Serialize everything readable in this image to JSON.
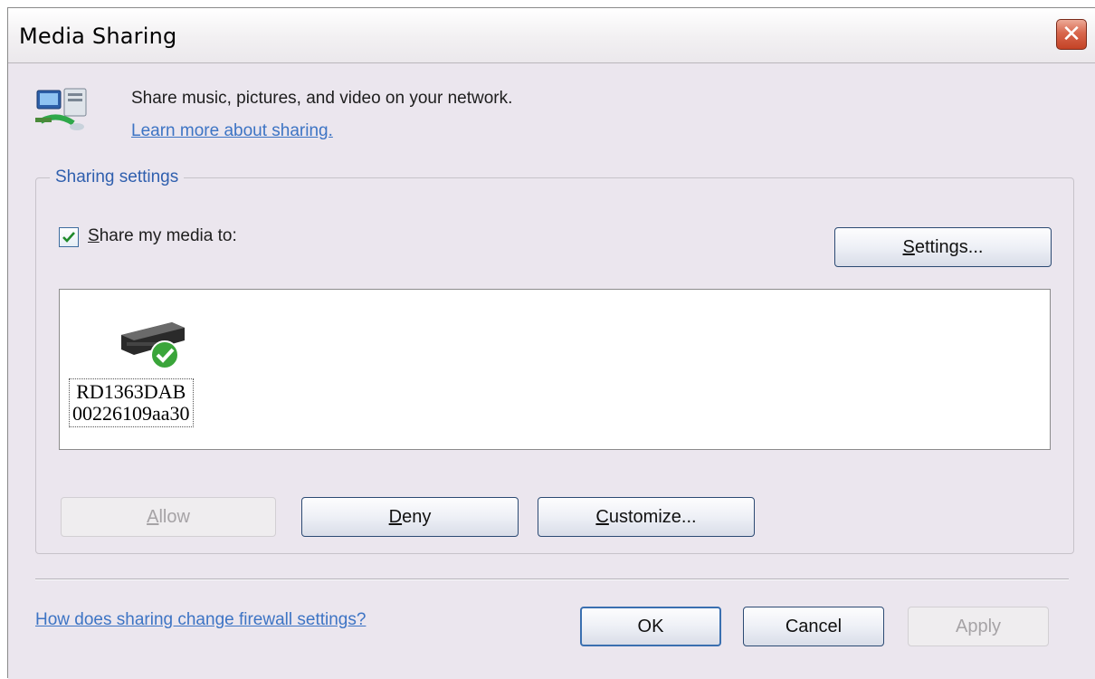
{
  "window": {
    "title": "Media Sharing",
    "close_symbol": "✕"
  },
  "header": {
    "icon": "network-sharing-icon",
    "description": "Share music, pictures, and video on your network.",
    "learn_more_link": "Learn more about sharing."
  },
  "sharing_settings": {
    "group_title": "Sharing settings",
    "share_checkbox": {
      "checked": true,
      "label_access_key": "S",
      "label_rest": "hare my media to:"
    },
    "settings_button": {
      "access_key": "S",
      "rest": "ettings..."
    },
    "devices": [
      {
        "icon": "media-device-allowed-icon",
        "name_line1": "RD1363DAB",
        "name_line2": "00226109aa30",
        "status": "allowed"
      }
    ],
    "allow_button": {
      "access_key": "A",
      "rest": "llow",
      "enabled": false
    },
    "deny_button": {
      "access_key": "D",
      "rest": "eny",
      "enabled": true
    },
    "customize_button": {
      "access_key": "C",
      "rest": "ustomize...",
      "enabled": true
    }
  },
  "footer": {
    "firewall_link": "How does sharing change firewall settings?",
    "ok_button": "OK",
    "cancel_button": "Cancel",
    "apply_button": "Apply",
    "apply_enabled": false
  },
  "colors": {
    "link": "#3d74c4",
    "group_title": "#2f5fae",
    "close_button": "#c44326",
    "dialog_background": "#ebe6ee"
  }
}
